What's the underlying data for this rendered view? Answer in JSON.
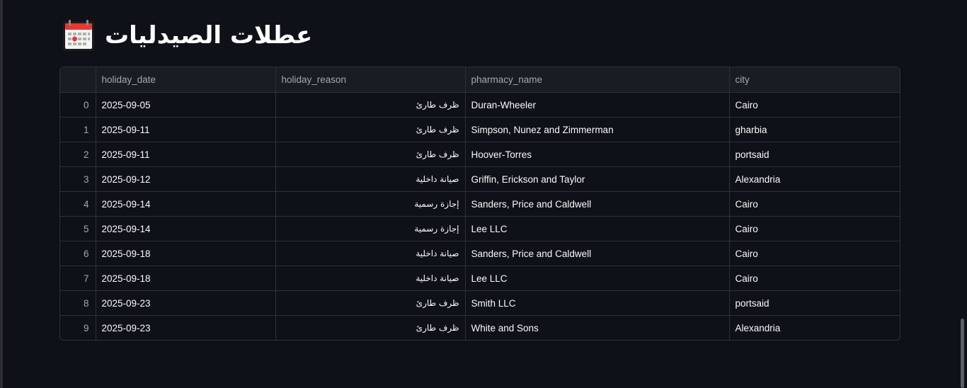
{
  "page": {
    "title": "عطلات الصيدليات",
    "icon": "calendar-icon"
  },
  "table": {
    "columns": [
      "",
      "holiday_date",
      "holiday_reason",
      "pharmacy_name",
      "city"
    ],
    "rows": [
      {
        "index": "0",
        "holiday_date": "2025-09-05",
        "holiday_reason": "ظرف طارئ",
        "pharmacy_name": "Duran-Wheeler",
        "city": "Cairo"
      },
      {
        "index": "1",
        "holiday_date": "2025-09-11",
        "holiday_reason": "ظرف طارئ",
        "pharmacy_name": "Simpson, Nunez and Zimmerman",
        "city": "gharbia"
      },
      {
        "index": "2",
        "holiday_date": "2025-09-11",
        "holiday_reason": "ظرف طارئ",
        "pharmacy_name": "Hoover-Torres",
        "city": "portsaid"
      },
      {
        "index": "3",
        "holiday_date": "2025-09-12",
        "holiday_reason": "صيانة داخلية",
        "pharmacy_name": "Griffin, Erickson and Taylor",
        "city": "Alexandria"
      },
      {
        "index": "4",
        "holiday_date": "2025-09-14",
        "holiday_reason": "إجازة رسمية",
        "pharmacy_name": "Sanders, Price and Caldwell",
        "city": "Cairo"
      },
      {
        "index": "5",
        "holiday_date": "2025-09-14",
        "holiday_reason": "إجازة رسمية",
        "pharmacy_name": "Lee LLC",
        "city": "Cairo"
      },
      {
        "index": "6",
        "holiday_date": "2025-09-18",
        "holiday_reason": "صيانة داخلية",
        "pharmacy_name": "Sanders, Price and Caldwell",
        "city": "Cairo"
      },
      {
        "index": "7",
        "holiday_date": "2025-09-18",
        "holiday_reason": "صيانة داخلية",
        "pharmacy_name": "Lee LLC",
        "city": "Cairo"
      },
      {
        "index": "8",
        "holiday_date": "2025-09-23",
        "holiday_reason": "ظرف طارئ",
        "pharmacy_name": "Smith LLC",
        "city": "portsaid"
      },
      {
        "index": "9",
        "holiday_date": "2025-09-23",
        "holiday_reason": "ظرف طارئ",
        "pharmacy_name": "White and Sons",
        "city": "Alexandria"
      }
    ]
  },
  "colors": {
    "background": "#0e1117",
    "header_bg": "#1a1c23",
    "grid_line": "#2f3138",
    "muted_text": "#a3a8b4",
    "text": "#fafafa"
  }
}
